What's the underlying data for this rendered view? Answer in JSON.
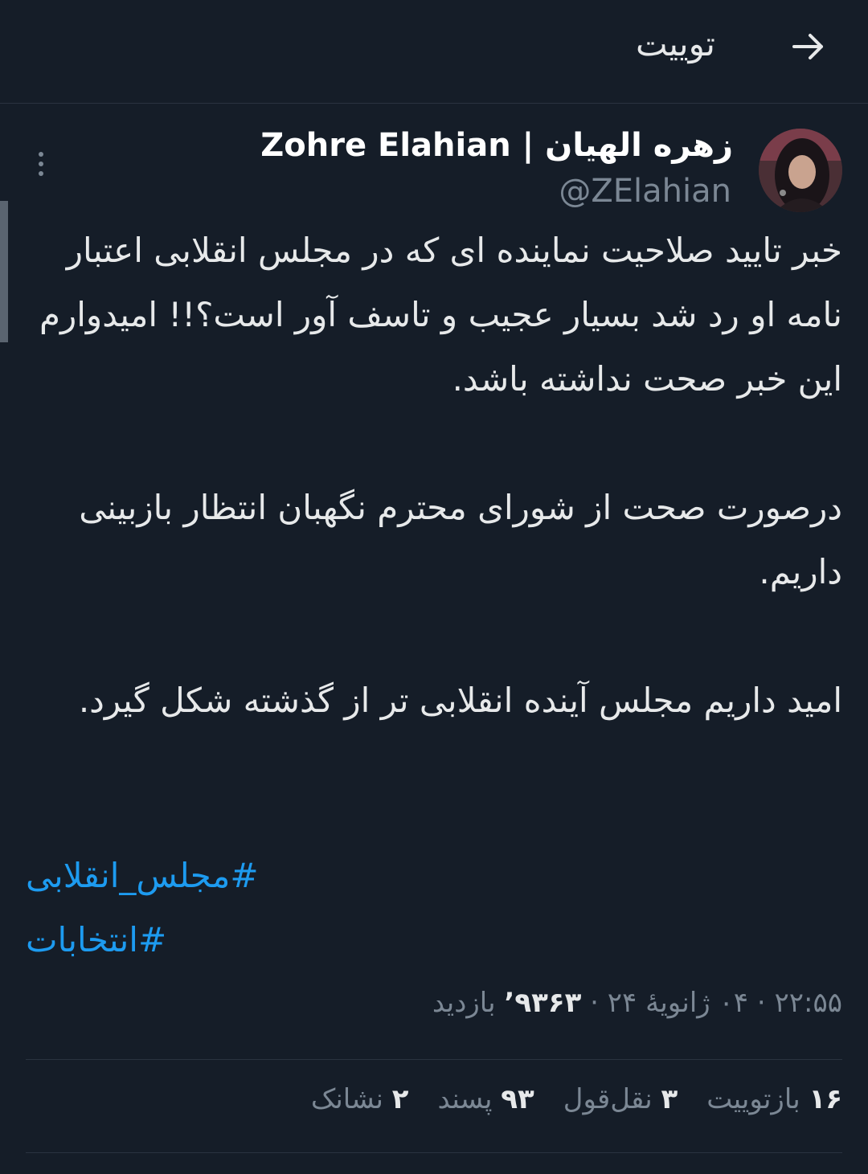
{
  "header": {
    "title": "توییت"
  },
  "tweet": {
    "display_name": "زهره الهیان | Zohre Elahian",
    "handle": "@ZElahian",
    "paragraphs": [
      "خبر تایید صلاحیت نماینده ای که در مجلس انقلابی اعتبار نامه او رد شد بسیار عجیب و تاسف آور است؟!! امیدوارم این خبر صحت نداشته باشد.",
      "درصورت صحت از شورای محترم نگهبان انتظار بازبینی داریم.",
      "امید داریم مجلس آینده انقلابی تر از گذشته شکل گیرد."
    ],
    "hashtags": [
      "#مجلس_انقلابی",
      "#انتخابات"
    ],
    "meta": {
      "time": "۲۲:۵۵",
      "date": "۰۴ ژانویهٔ ۲۴",
      "views_count": "۹۳۶۳’",
      "views_label": "بازدید"
    },
    "stats": [
      {
        "num": "۱۶",
        "label": "بازتوییت"
      },
      {
        "num": "۳",
        "label": "نقل‌قول"
      },
      {
        "num": "۹۳",
        "label": "پسند"
      },
      {
        "num": "۲",
        "label": "نشانک"
      }
    ]
  },
  "colors": {
    "background": "#151d28",
    "text": "#e7e9ea",
    "muted": "#7b8794",
    "link": "#1d9bf0",
    "divider": "#2a3340"
  },
  "icons": {
    "back": "arrow-right-icon",
    "more": "more-vertical-icon"
  }
}
